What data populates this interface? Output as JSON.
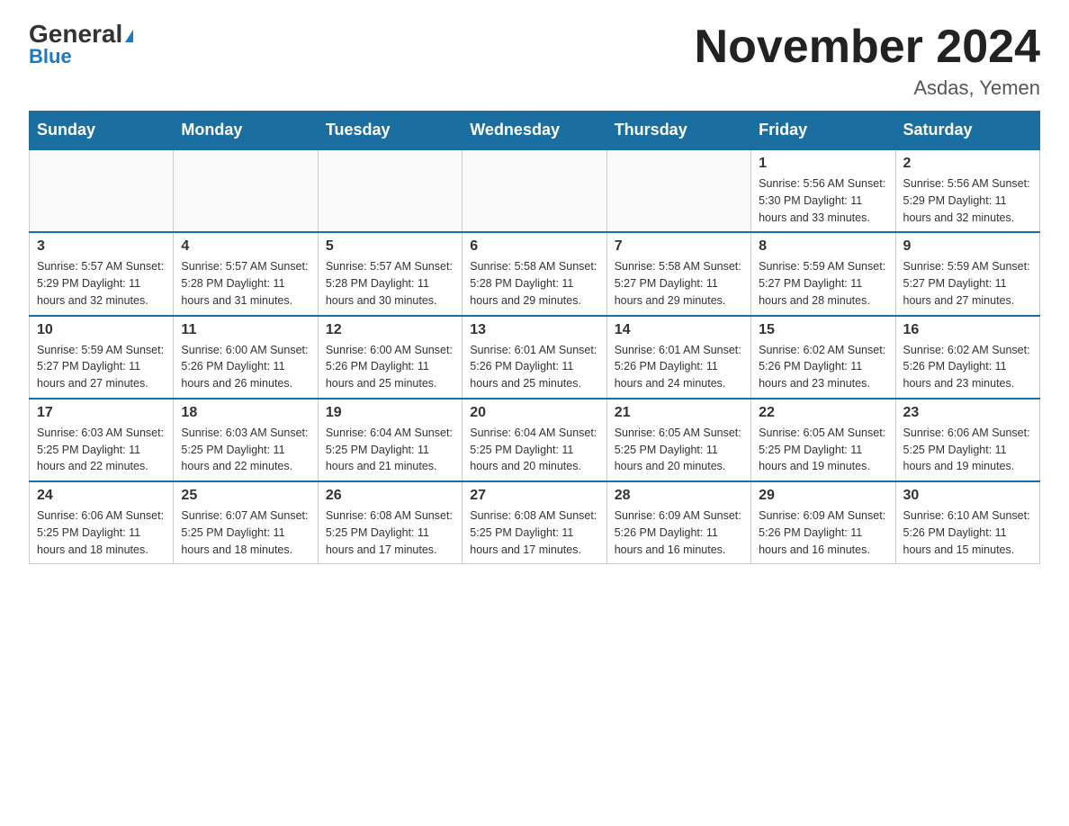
{
  "logo": {
    "general": "General",
    "blue": "Blue"
  },
  "title": "November 2024",
  "subtitle": "Asdas, Yemen",
  "days_of_week": [
    "Sunday",
    "Monday",
    "Tuesday",
    "Wednesday",
    "Thursday",
    "Friday",
    "Saturday"
  ],
  "weeks": [
    [
      {
        "day": "",
        "info": ""
      },
      {
        "day": "",
        "info": ""
      },
      {
        "day": "",
        "info": ""
      },
      {
        "day": "",
        "info": ""
      },
      {
        "day": "",
        "info": ""
      },
      {
        "day": "1",
        "info": "Sunrise: 5:56 AM\nSunset: 5:30 PM\nDaylight: 11 hours\nand 33 minutes."
      },
      {
        "day": "2",
        "info": "Sunrise: 5:56 AM\nSunset: 5:29 PM\nDaylight: 11 hours\nand 32 minutes."
      }
    ],
    [
      {
        "day": "3",
        "info": "Sunrise: 5:57 AM\nSunset: 5:29 PM\nDaylight: 11 hours\nand 32 minutes."
      },
      {
        "day": "4",
        "info": "Sunrise: 5:57 AM\nSunset: 5:28 PM\nDaylight: 11 hours\nand 31 minutes."
      },
      {
        "day": "5",
        "info": "Sunrise: 5:57 AM\nSunset: 5:28 PM\nDaylight: 11 hours\nand 30 minutes."
      },
      {
        "day": "6",
        "info": "Sunrise: 5:58 AM\nSunset: 5:28 PM\nDaylight: 11 hours\nand 29 minutes."
      },
      {
        "day": "7",
        "info": "Sunrise: 5:58 AM\nSunset: 5:27 PM\nDaylight: 11 hours\nand 29 minutes."
      },
      {
        "day": "8",
        "info": "Sunrise: 5:59 AM\nSunset: 5:27 PM\nDaylight: 11 hours\nand 28 minutes."
      },
      {
        "day": "9",
        "info": "Sunrise: 5:59 AM\nSunset: 5:27 PM\nDaylight: 11 hours\nand 27 minutes."
      }
    ],
    [
      {
        "day": "10",
        "info": "Sunrise: 5:59 AM\nSunset: 5:27 PM\nDaylight: 11 hours\nand 27 minutes."
      },
      {
        "day": "11",
        "info": "Sunrise: 6:00 AM\nSunset: 5:26 PM\nDaylight: 11 hours\nand 26 minutes."
      },
      {
        "day": "12",
        "info": "Sunrise: 6:00 AM\nSunset: 5:26 PM\nDaylight: 11 hours\nand 25 minutes."
      },
      {
        "day": "13",
        "info": "Sunrise: 6:01 AM\nSunset: 5:26 PM\nDaylight: 11 hours\nand 25 minutes."
      },
      {
        "day": "14",
        "info": "Sunrise: 6:01 AM\nSunset: 5:26 PM\nDaylight: 11 hours\nand 24 minutes."
      },
      {
        "day": "15",
        "info": "Sunrise: 6:02 AM\nSunset: 5:26 PM\nDaylight: 11 hours\nand 23 minutes."
      },
      {
        "day": "16",
        "info": "Sunrise: 6:02 AM\nSunset: 5:26 PM\nDaylight: 11 hours\nand 23 minutes."
      }
    ],
    [
      {
        "day": "17",
        "info": "Sunrise: 6:03 AM\nSunset: 5:25 PM\nDaylight: 11 hours\nand 22 minutes."
      },
      {
        "day": "18",
        "info": "Sunrise: 6:03 AM\nSunset: 5:25 PM\nDaylight: 11 hours\nand 22 minutes."
      },
      {
        "day": "19",
        "info": "Sunrise: 6:04 AM\nSunset: 5:25 PM\nDaylight: 11 hours\nand 21 minutes."
      },
      {
        "day": "20",
        "info": "Sunrise: 6:04 AM\nSunset: 5:25 PM\nDaylight: 11 hours\nand 20 minutes."
      },
      {
        "day": "21",
        "info": "Sunrise: 6:05 AM\nSunset: 5:25 PM\nDaylight: 11 hours\nand 20 minutes."
      },
      {
        "day": "22",
        "info": "Sunrise: 6:05 AM\nSunset: 5:25 PM\nDaylight: 11 hours\nand 19 minutes."
      },
      {
        "day": "23",
        "info": "Sunrise: 6:06 AM\nSunset: 5:25 PM\nDaylight: 11 hours\nand 19 minutes."
      }
    ],
    [
      {
        "day": "24",
        "info": "Sunrise: 6:06 AM\nSunset: 5:25 PM\nDaylight: 11 hours\nand 18 minutes."
      },
      {
        "day": "25",
        "info": "Sunrise: 6:07 AM\nSunset: 5:25 PM\nDaylight: 11 hours\nand 18 minutes."
      },
      {
        "day": "26",
        "info": "Sunrise: 6:08 AM\nSunset: 5:25 PM\nDaylight: 11 hours\nand 17 minutes."
      },
      {
        "day": "27",
        "info": "Sunrise: 6:08 AM\nSunset: 5:25 PM\nDaylight: 11 hours\nand 17 minutes."
      },
      {
        "day": "28",
        "info": "Sunrise: 6:09 AM\nSunset: 5:26 PM\nDaylight: 11 hours\nand 16 minutes."
      },
      {
        "day": "29",
        "info": "Sunrise: 6:09 AM\nSunset: 5:26 PM\nDaylight: 11 hours\nand 16 minutes."
      },
      {
        "day": "30",
        "info": "Sunrise: 6:10 AM\nSunset: 5:26 PM\nDaylight: 11 hours\nand 15 minutes."
      }
    ]
  ]
}
